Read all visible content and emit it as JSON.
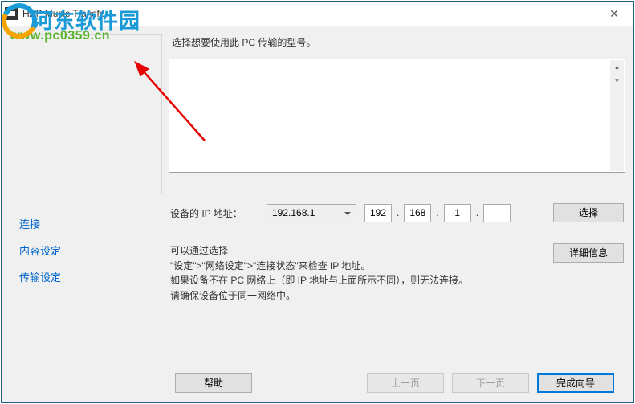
{
  "titlebar": {
    "title": "HAP Music Transfer",
    "close": "✕"
  },
  "watermark": {
    "site_name": "河东软件园",
    "url": "www.pc0359.cn"
  },
  "sidebar": {
    "nav": [
      {
        "label": "连接"
      },
      {
        "label": "内容设定"
      },
      {
        "label": "传输设定"
      }
    ]
  },
  "main": {
    "instruction": "选择想要使用此 PC 传输的型号。",
    "ip_label": "设备的 IP 地址：",
    "ip_select_value": "192.168.1",
    "ip_parts": [
      "192",
      "168",
      "1",
      ""
    ],
    "select_btn": "选择",
    "info_text_label": "可以通过选择",
    "info_lines": [
      "\"设定\">\"网络设定\">\"连接状态\"来检查 IP 地址。",
      "如果设备不在 PC 网络上（即 IP 地址与上面所示不同），则无法连接。",
      "请确保设备位于同一网络中。"
    ],
    "detail_btn": "详细信息"
  },
  "footer": {
    "help": "帮助",
    "prev": "上一页",
    "next": "下一页",
    "finish": "完成向导"
  },
  "scrollbar_glyphs": {
    "up": "▴",
    "down": "▾"
  }
}
